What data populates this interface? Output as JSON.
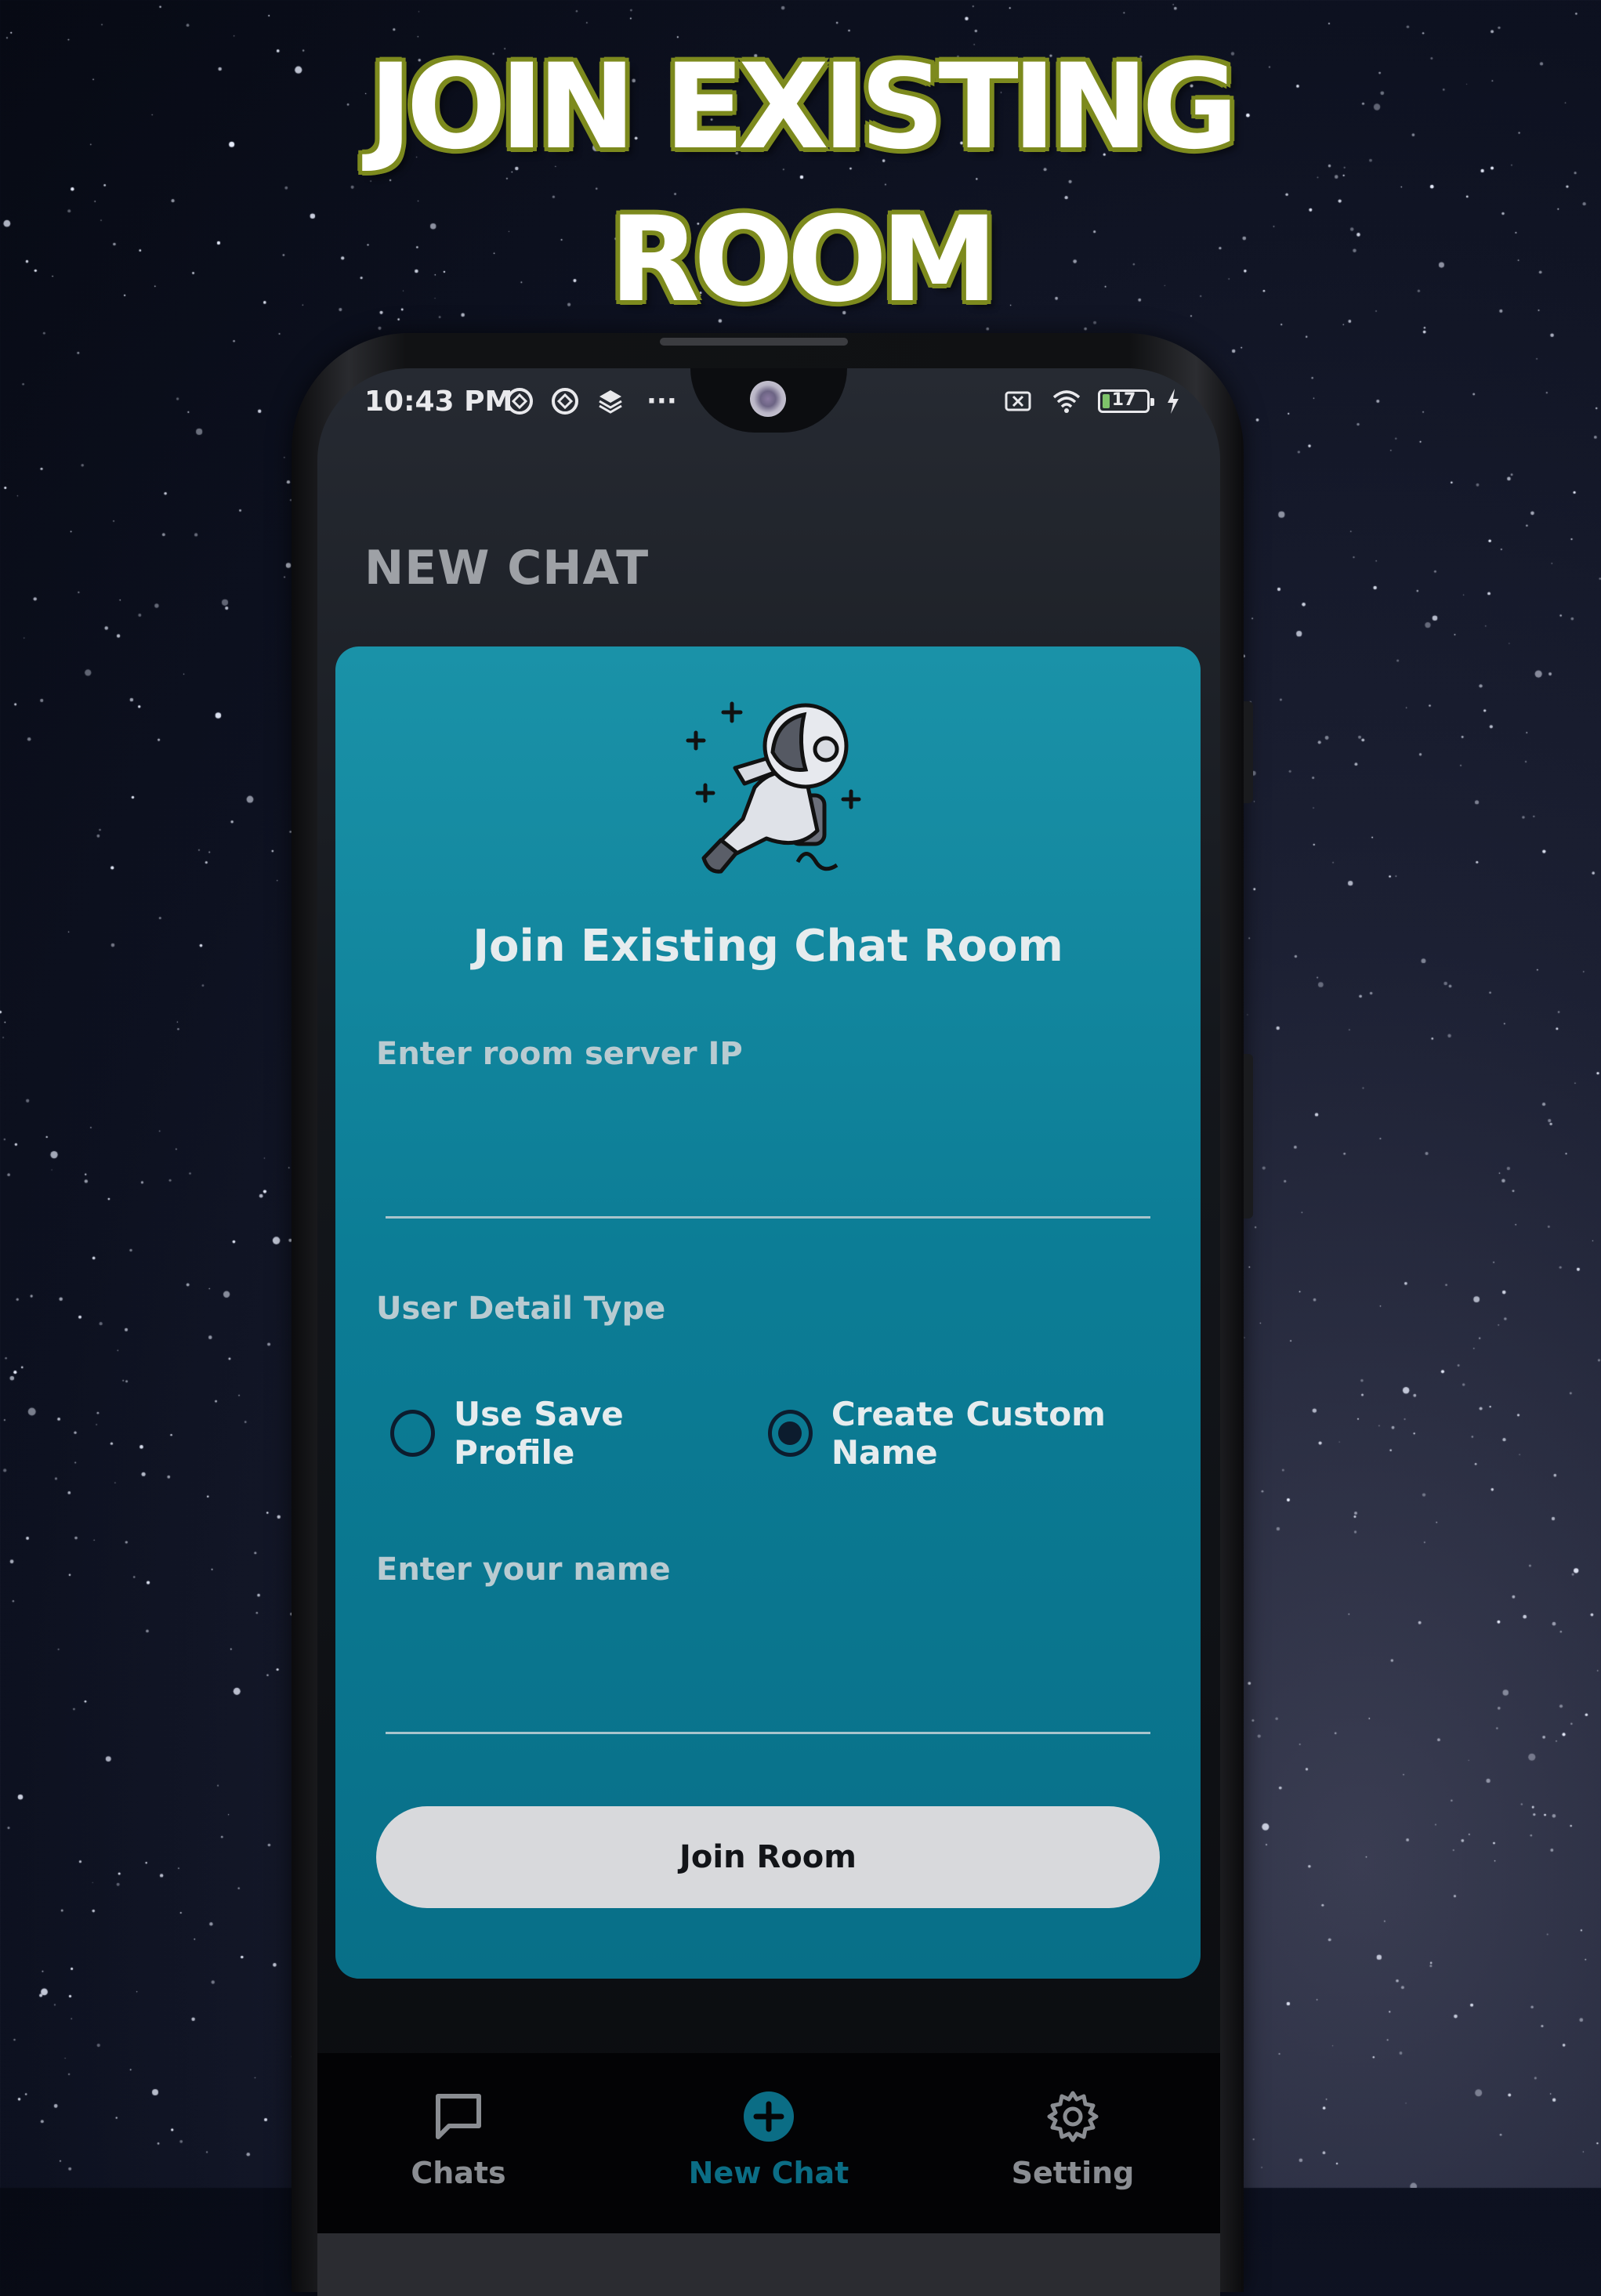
{
  "headline": {
    "line1": "JOIN EXISTING",
    "line2": "ROOM"
  },
  "status_bar": {
    "time": "10:43 PM",
    "more": "···",
    "battery_level": "17"
  },
  "page": {
    "title": "NEW CHAT"
  },
  "card": {
    "title": "Join Existing Chat Room",
    "server_ip": {
      "label": "Enter room server IP",
      "value": "",
      "placeholder": ""
    },
    "user_detail": {
      "label": "User Detail Type",
      "options": [
        "Use Save Profile",
        "Create Custom Name"
      ],
      "selected": "Create Custom Name"
    },
    "name": {
      "label": "Enter your name",
      "value": "",
      "placeholder": ""
    },
    "join_label": "Join Room"
  },
  "nav": {
    "items": [
      {
        "label": "Chats",
        "icon": "chat-bubble-icon",
        "active": false
      },
      {
        "label": "New Chat",
        "icon": "plus-circle-icon",
        "active": true
      },
      {
        "label": "Setting",
        "icon": "gear-icon",
        "active": false
      }
    ],
    "active_color": "#0b6d85",
    "inactive_color": "#8a8d92"
  },
  "colors": {
    "card": "#0c7d96",
    "headline_outline": "#7d8a1e"
  }
}
